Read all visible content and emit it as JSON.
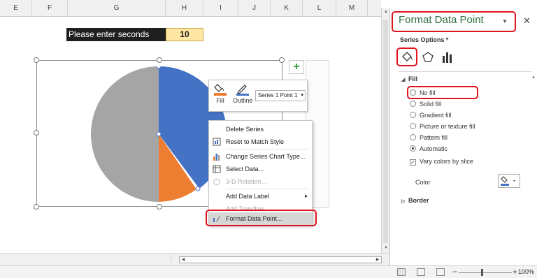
{
  "columns": [
    "E",
    "F",
    "G",
    "H",
    "I",
    "J",
    "K",
    "L",
    "M"
  ],
  "prompt": {
    "label": "Please enter seconds",
    "value": "10"
  },
  "chart_colors": {
    "blue": "#4472c4",
    "orange": "#ed7d31",
    "gray": "#a5a5a5"
  },
  "chart_add_button": "+",
  "mini_toolbar": {
    "fill_label": "Fill",
    "outline_label": "Outline",
    "selector_value": "Series 1 Point 1"
  },
  "context_menu": {
    "items": [
      {
        "label": "Delete Series",
        "icon": "none"
      },
      {
        "label": "Reset to Match Style",
        "icon": "reset-style-icon"
      },
      {
        "label": "Change Series Chart Type...",
        "icon": "bar-chart-icon"
      },
      {
        "label": "Select Data...",
        "icon": "select-data-icon"
      },
      {
        "label": "3-D Rotation...",
        "icon": "3d-rotation-icon",
        "disabled": true
      },
      {
        "label": "Add Data Label",
        "icon": "none",
        "submenu": true
      },
      {
        "label": "Add Trendline...",
        "icon": "none",
        "disabled": true
      },
      {
        "label": "Format Data Point...",
        "icon": "format-data-point-icon",
        "selected": true
      }
    ],
    "submenu_arrow": "▸"
  },
  "pane": {
    "title": "Format Data Point",
    "title_chevron": "▼",
    "close": "✕",
    "series_options": "Series Options",
    "series_options_chevron": "▼",
    "fill_section": {
      "label": "Fill",
      "toggle": "◢"
    },
    "fill_options": [
      {
        "label": "No fill",
        "checked": false
      },
      {
        "label": "Solid fill",
        "checked": false
      },
      {
        "label": "Gradient fill",
        "checked": false
      },
      {
        "label": "Picture or texture fill",
        "checked": false
      },
      {
        "label": "Pattern fill",
        "checked": false
      },
      {
        "label": "Automatic",
        "checked": true
      }
    ],
    "vary_colors": {
      "label": "Vary colors by slice",
      "checked": true,
      "mark": "✓"
    },
    "color_label": "Color",
    "border_section": {
      "label": "Border",
      "toggle": "▷"
    }
  },
  "status": {
    "zoom": "100%",
    "zoom_minus": "−",
    "zoom_plus": "+"
  }
}
